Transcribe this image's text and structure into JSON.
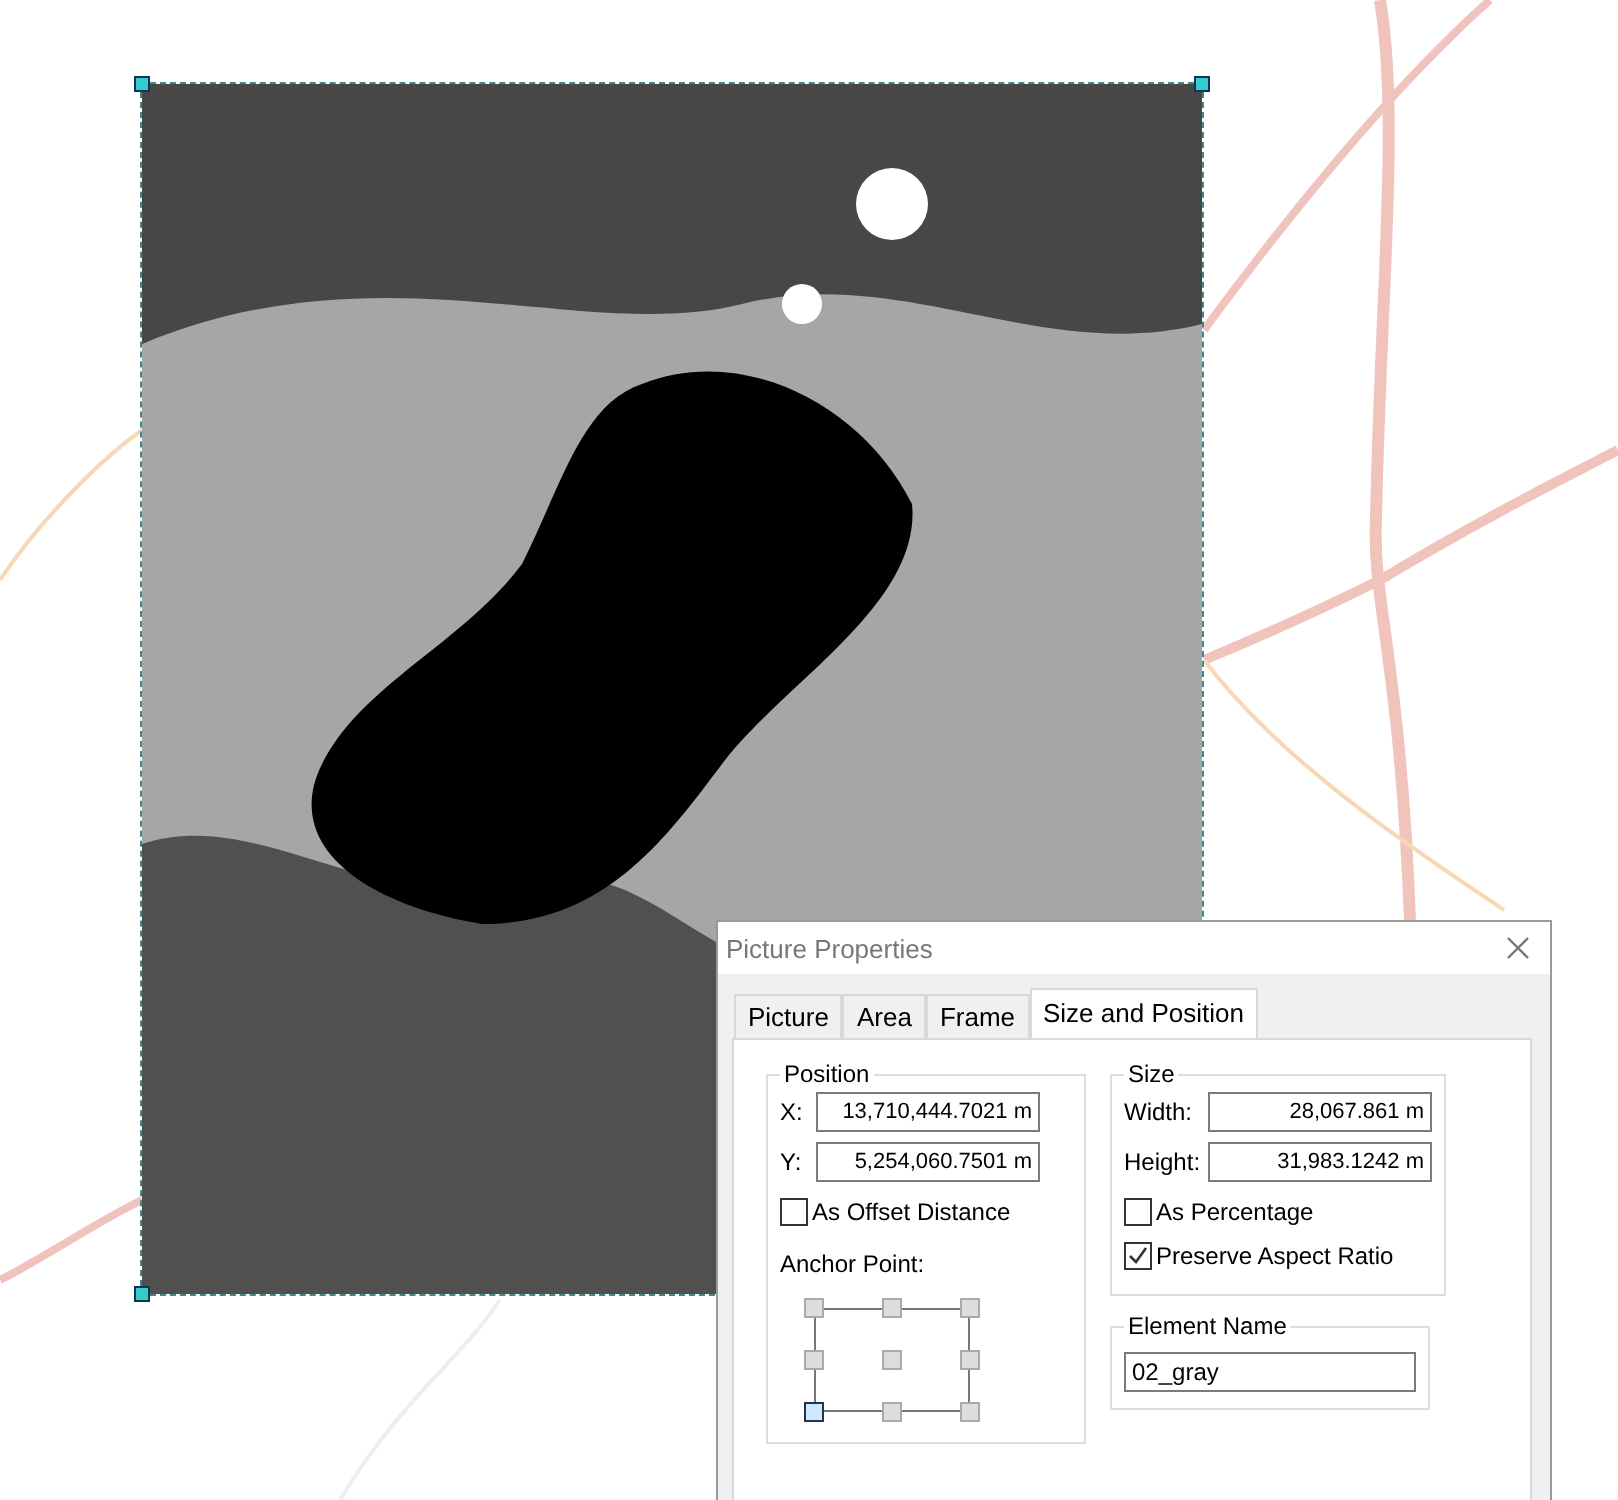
{
  "dialog": {
    "title": "Picture Properties",
    "tabs": [
      {
        "label": "Picture",
        "selected": false
      },
      {
        "label": "Area",
        "selected": false
      },
      {
        "label": "Frame",
        "selected": false
      },
      {
        "label": "Size and Position",
        "selected": true
      }
    ],
    "position": {
      "title": "Position",
      "x_label": "X:",
      "x_value": "13,710,444.7021 m",
      "y_label": "Y:",
      "y_value": "5,254,060.7501 m",
      "offset": {
        "label": "As Offset Distance",
        "checked": false
      },
      "anchor_label": "Anchor Point:",
      "anchor_points": [
        {
          "selected": false
        },
        {
          "selected": false
        },
        {
          "selected": false
        },
        {
          "selected": false
        },
        {
          "selected": false
        },
        {
          "selected": false
        },
        {
          "selected": true
        },
        {
          "selected": false
        },
        {
          "selected": false
        }
      ]
    },
    "size": {
      "title": "Size",
      "width_label": "Width:",
      "width_value": "28,067.861 m",
      "height_label": "Height:",
      "height_value": "31,983.1242 m",
      "checks": [
        {
          "label": "As Percentage",
          "checked": false
        },
        {
          "label": "Preserve Aspect Ratio",
          "checked": true
        }
      ]
    },
    "element_name": {
      "title": "Element Name",
      "value": "02_gray"
    }
  }
}
